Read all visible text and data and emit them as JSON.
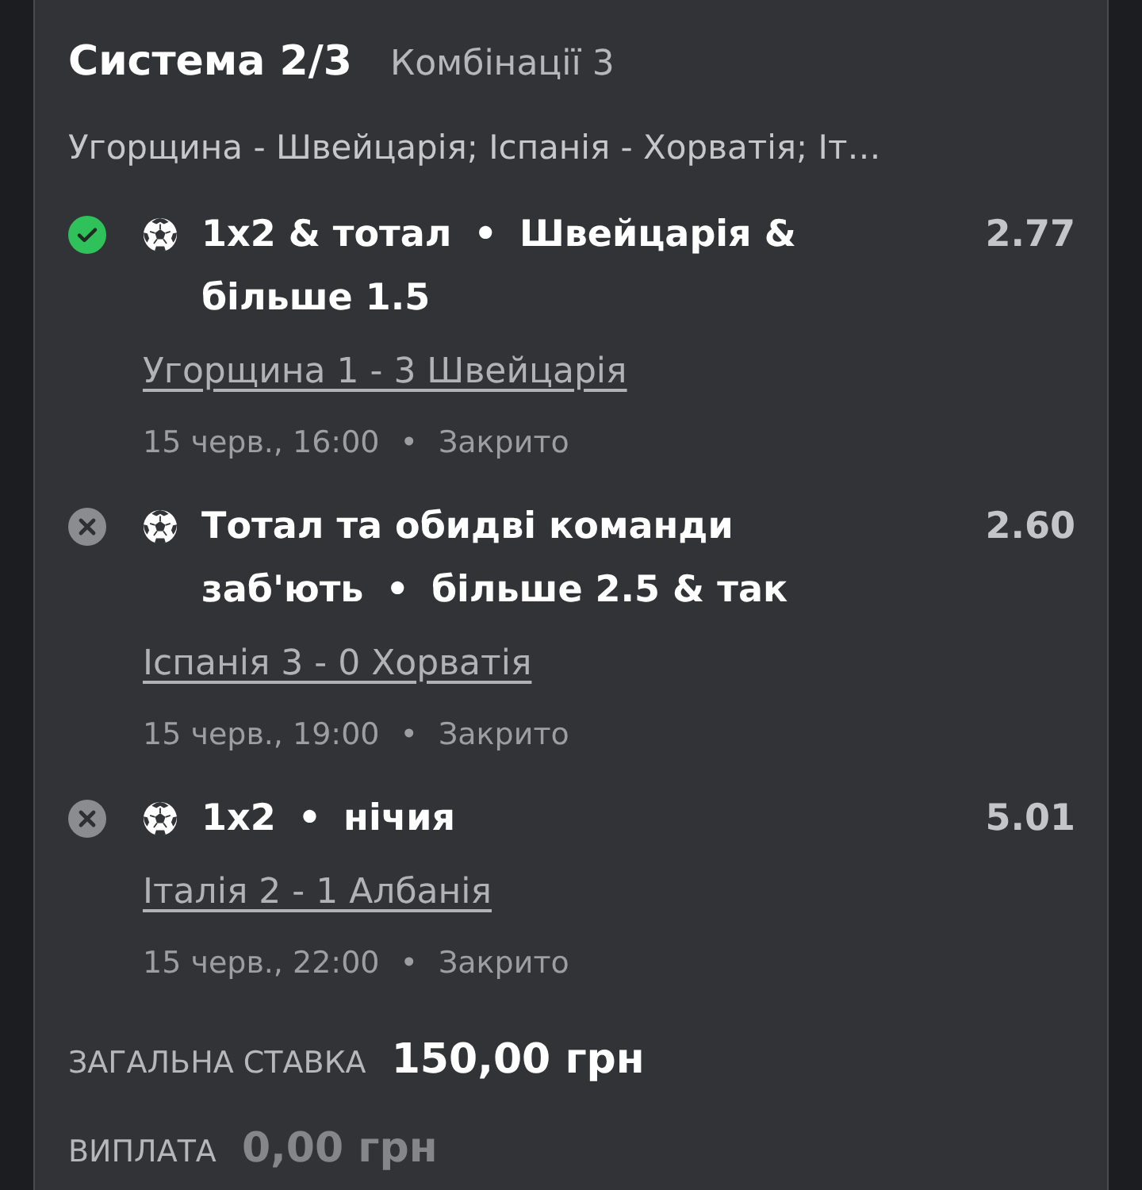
{
  "header": {
    "title": "Система 2/3",
    "combinations": "Комбінації 3",
    "events": "Угорщина - Швейцарія; Іспанія - Хорватія; Іт…"
  },
  "selections": [
    {
      "won": true,
      "market": "1x2 & тотал",
      "separator": "•",
      "pick": "Швейцарія & більше 1.5",
      "odds": "2.77",
      "match": "Угорщина 1 - 3 Швейцарія",
      "time": "15 черв., 16:00",
      "time_separator": "•",
      "state": "Закрито"
    },
    {
      "won": false,
      "market": "Тотал та обидві команди заб'ють",
      "separator": "•",
      "pick": "більше 2.5 & так",
      "odds": "2.60",
      "match": "Іспанія 3 - 0 Хорватія",
      "time": "15 черв., 19:00",
      "time_separator": "•",
      "state": "Закрито"
    },
    {
      "won": false,
      "market": "1x2",
      "separator": "•",
      "pick": "нічия",
      "odds": "5.01",
      "match": "Італія 2 - 1 Албанія",
      "time": "15 черв., 22:00",
      "time_separator": "•",
      "state": "Закрито"
    }
  ],
  "stake": {
    "label": "ЗАГАЛЬНА СТАВКА",
    "value": "150,00 грн",
    "dimmed": false
  },
  "payout": {
    "label": "ВИПЛАТА",
    "value": "0,00 грн",
    "dimmed": true
  }
}
